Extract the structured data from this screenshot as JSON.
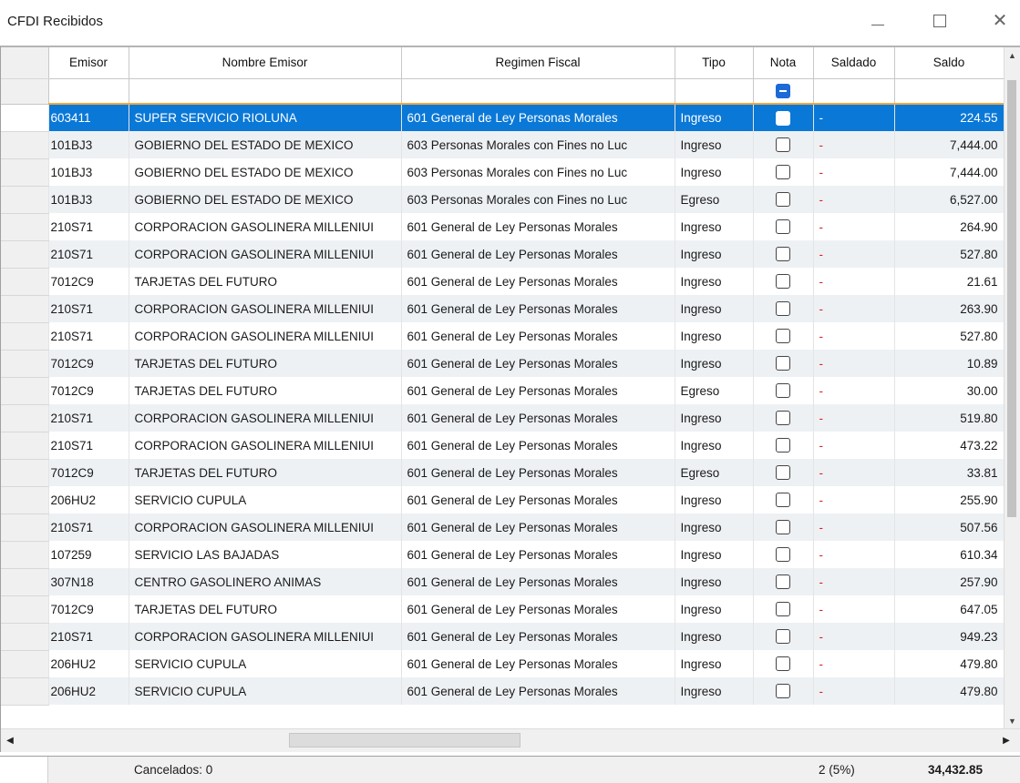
{
  "window": {
    "title": "CFDI Recibidos"
  },
  "columns": [
    "Emisor",
    "Nombre Emisor",
    "Regimen Fiscal",
    "Tipo",
    "Nota",
    "Saldado",
    "Saldo"
  ],
  "rows": [
    {
      "emisor": "603411",
      "nombre": "SUPER SERVICIO RIOLUNA",
      "regimen": "601 General de Ley Personas Morales",
      "tipo": "Ingreso",
      "saldado": "-",
      "saldo": "224.55"
    },
    {
      "emisor": "101BJ3",
      "nombre": "GOBIERNO DEL ESTADO DE MEXICO",
      "regimen": "603 Personas Morales con Fines no Luc",
      "tipo": "Ingreso",
      "saldado": "-",
      "saldo": "7,444.00"
    },
    {
      "emisor": "101BJ3",
      "nombre": "GOBIERNO DEL ESTADO DE MEXICO",
      "regimen": "603 Personas Morales con Fines no Luc",
      "tipo": "Ingreso",
      "saldado": "-",
      "saldo": "7,444.00"
    },
    {
      "emisor": "101BJ3",
      "nombre": "GOBIERNO DEL ESTADO DE MEXICO",
      "regimen": "603 Personas Morales con Fines no Luc",
      "tipo": "Egreso",
      "saldado": "-",
      "saldo": "6,527.00"
    },
    {
      "emisor": "210S71",
      "nombre": "CORPORACION GASOLINERA MILLENIUI",
      "regimen": "601 General de Ley Personas Morales",
      "tipo": "Ingreso",
      "saldado": "-",
      "saldo": "264.90"
    },
    {
      "emisor": "210S71",
      "nombre": "CORPORACION GASOLINERA MILLENIUI",
      "regimen": "601 General de Ley Personas Morales",
      "tipo": "Ingreso",
      "saldado": "-",
      "saldo": "527.80"
    },
    {
      "emisor": "7012C9",
      "nombre": "TARJETAS DEL FUTURO",
      "regimen": "601 General de Ley Personas Morales",
      "tipo": "Ingreso",
      "saldado": "-",
      "saldo": "21.61"
    },
    {
      "emisor": "210S71",
      "nombre": "CORPORACION GASOLINERA MILLENIUI",
      "regimen": "601 General de Ley Personas Morales",
      "tipo": "Ingreso",
      "saldado": "-",
      "saldo": "263.90"
    },
    {
      "emisor": "210S71",
      "nombre": "CORPORACION GASOLINERA MILLENIUI",
      "regimen": "601 General de Ley Personas Morales",
      "tipo": "Ingreso",
      "saldado": "-",
      "saldo": "527.80"
    },
    {
      "emisor": "7012C9",
      "nombre": "TARJETAS DEL FUTURO",
      "regimen": "601 General de Ley Personas Morales",
      "tipo": "Ingreso",
      "saldado": "-",
      "saldo": "10.89"
    },
    {
      "emisor": "7012C9",
      "nombre": "TARJETAS DEL FUTURO",
      "regimen": "601 General de Ley Personas Morales",
      "tipo": "Egreso",
      "saldado": "-",
      "saldo": "30.00"
    },
    {
      "emisor": "210S71",
      "nombre": "CORPORACION GASOLINERA MILLENIUI",
      "regimen": "601 General de Ley Personas Morales",
      "tipo": "Ingreso",
      "saldado": "-",
      "saldo": "519.80"
    },
    {
      "emisor": "210S71",
      "nombre": "CORPORACION GASOLINERA MILLENIUI",
      "regimen": "601 General de Ley Personas Morales",
      "tipo": "Ingreso",
      "saldado": "-",
      "saldo": "473.22"
    },
    {
      "emisor": "7012C9",
      "nombre": "TARJETAS DEL FUTURO",
      "regimen": "601 General de Ley Personas Morales",
      "tipo": "Egreso",
      "saldado": "-",
      "saldo": "33.81"
    },
    {
      "emisor": "206HU2",
      "nombre": "SERVICIO CUPULA",
      "regimen": "601 General de Ley Personas Morales",
      "tipo": "Ingreso",
      "saldado": "-",
      "saldo": "255.90"
    },
    {
      "emisor": "210S71",
      "nombre": "CORPORACION GASOLINERA MILLENIUI",
      "regimen": "601 General de Ley Personas Morales",
      "tipo": "Ingreso",
      "saldado": "-",
      "saldo": "507.56"
    },
    {
      "emisor": "107259",
      "nombre": "SERVICIO LAS BAJADAS",
      "regimen": "601 General de Ley Personas Morales",
      "tipo": "Ingreso",
      "saldado": "-",
      "saldo": "610.34"
    },
    {
      "emisor": "307N18",
      "nombre": "CENTRO GASOLINERO ANIMAS",
      "regimen": "601 General de Ley Personas Morales",
      "tipo": "Ingreso",
      "saldado": "-",
      "saldo": "257.90"
    },
    {
      "emisor": "7012C9",
      "nombre": "TARJETAS DEL FUTURO",
      "regimen": "601 General de Ley Personas Morales",
      "tipo": "Ingreso",
      "saldado": "-",
      "saldo": "647.05"
    },
    {
      "emisor": "210S71",
      "nombre": "CORPORACION GASOLINERA MILLENIUI",
      "regimen": "601 General de Ley Personas Morales",
      "tipo": "Ingreso",
      "saldado": "-",
      "saldo": "949.23"
    },
    {
      "emisor": "206HU2",
      "nombre": "SERVICIO CUPULA",
      "regimen": "601 General de Ley Personas Morales",
      "tipo": "Ingreso",
      "saldado": "-",
      "saldo": "479.80"
    },
    {
      "emisor": "206HU2",
      "nombre": "SERVICIO CUPULA",
      "regimen": "601 General de Ley Personas Morales",
      "tipo": "Ingreso",
      "saldado": "-",
      "saldo": "479.80"
    }
  ],
  "selected_row": 0,
  "footer": {
    "cancelados": "Cancelados: 0",
    "count": "2 (5%)",
    "total": "34,432.85"
  },
  "colors": {
    "selection": "#0a78d7",
    "filter_underline": "#f2a93b",
    "dash": "#e02020",
    "checkbox_accent": "#1c6ad6"
  },
  "icons": [
    "minimize-icon",
    "maximize-icon",
    "close-icon",
    "scroll-up-icon",
    "scroll-down-icon",
    "scroll-left-icon",
    "scroll-right-icon"
  ]
}
